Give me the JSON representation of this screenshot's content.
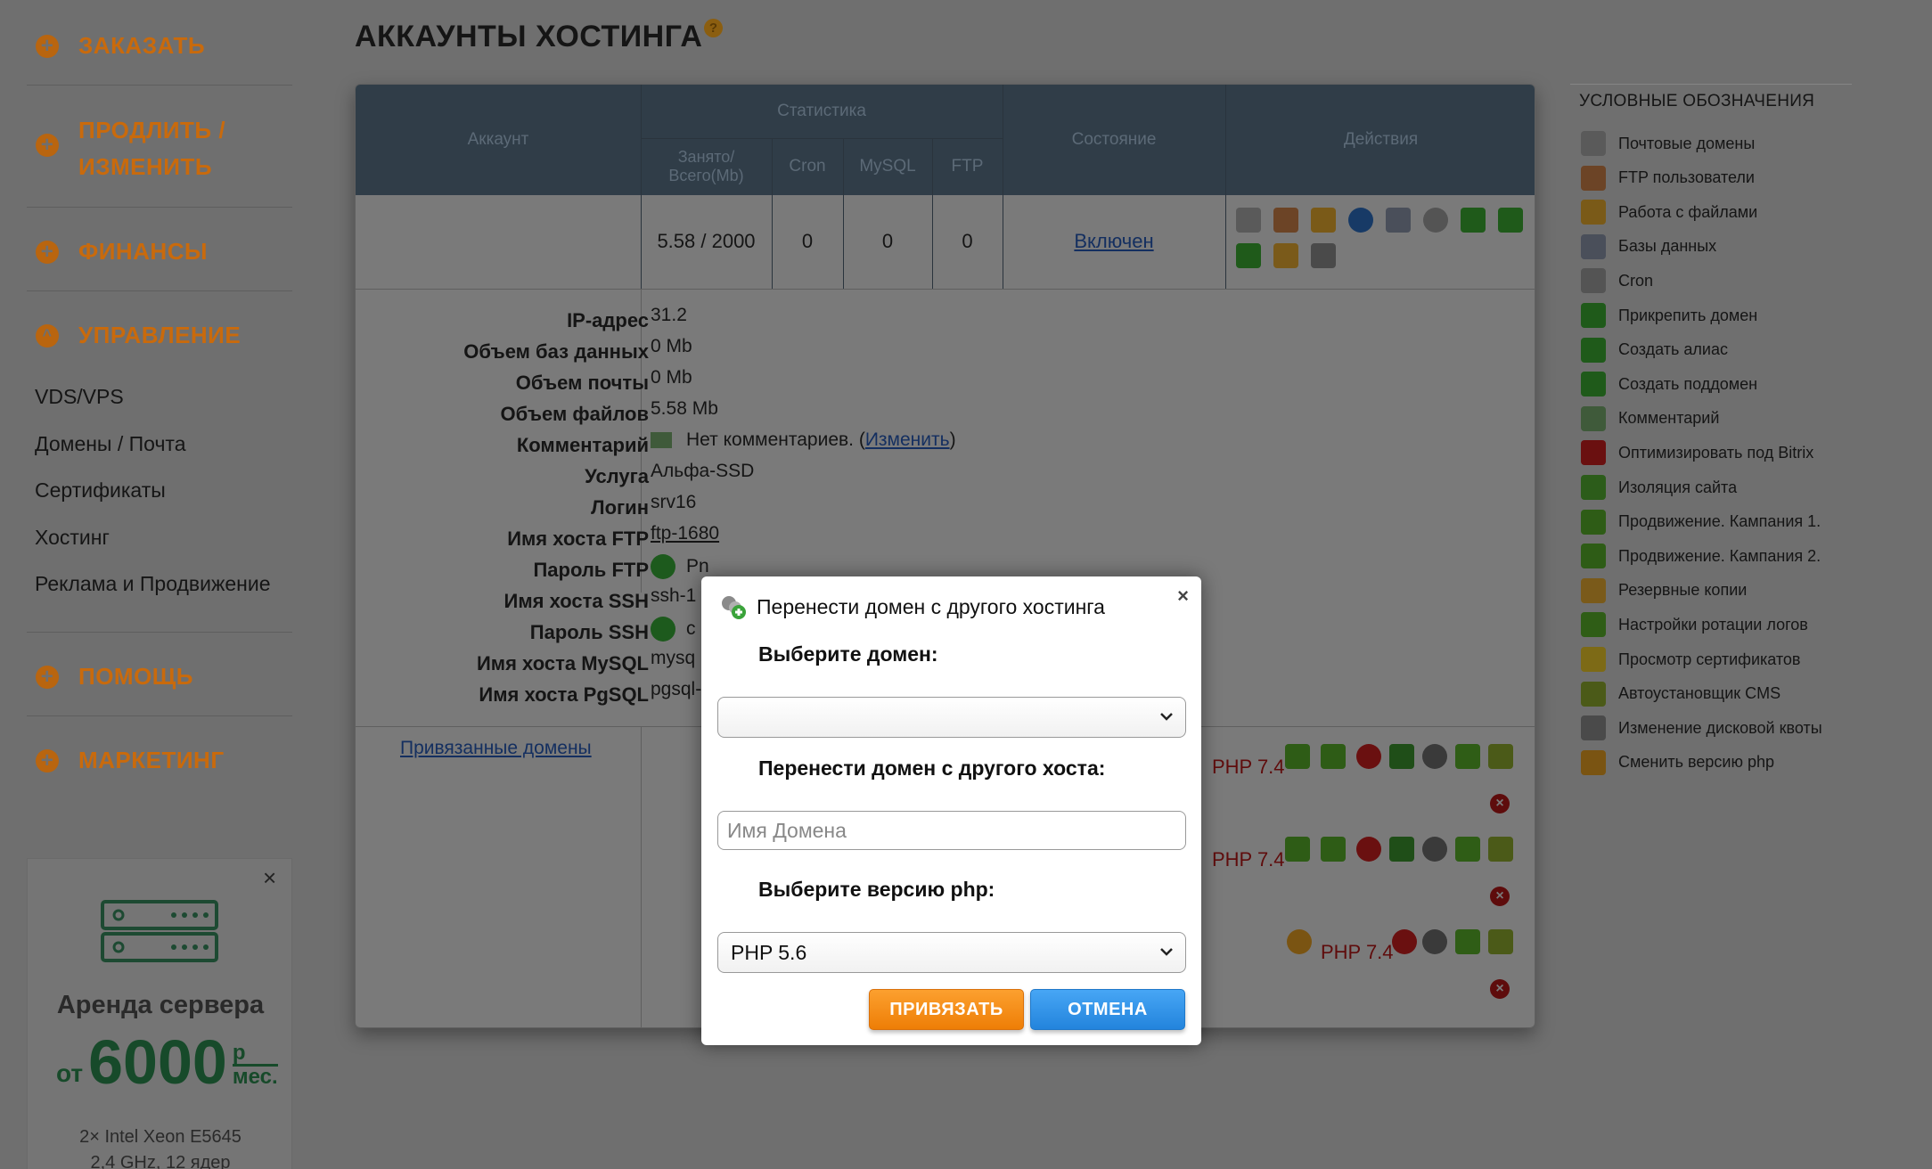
{
  "menu": {
    "order": "ЗАКАЗАТЬ",
    "renew_line1": "ПРОДЛИТЬ /",
    "renew_line2": "ИЗМЕНИТЬ",
    "finance": "ФИНАНСЫ",
    "manage": "УПРАВЛЕНИЕ",
    "manage_items": [
      "VDS/VPS",
      "Домены / Почта",
      "Сертификаты",
      "Хостинг",
      "Реклама и Продвижение"
    ],
    "help": "ПОМОЩЬ",
    "marketing": "МАРКЕТИНГ"
  },
  "ad": {
    "title": "Аренда сервера",
    "price_prefix": "от",
    "price": "6000",
    "unit_top": "р",
    "unit_bottom": "мес.",
    "spec1": "2× Intel Xeon E5645",
    "spec2": "2,4 GHz, 12 ядер",
    "close": "×"
  },
  "page": {
    "title": "АККАУНТЫ ХОСТИНГА",
    "help": "?"
  },
  "table": {
    "col_account": "Аккаунт",
    "col_stats": "Статистика",
    "col_used": "Занято/ Всего(Mb)",
    "col_cron": "Cron",
    "col_mysql": "MySQL",
    "col_ftp": "FTP",
    "col_state": "Состояние",
    "col_actions": "Действия",
    "row": {
      "used": "5.58 / 2000",
      "cron": "0",
      "mysql": "0",
      "ftp": "0",
      "state": "Включен"
    }
  },
  "details": {
    "labels": [
      "IP-адрес",
      "Объем баз данных",
      "Объем почты",
      "Объем файлов",
      "Комментарий",
      "Услуга",
      "Логин",
      "Имя хоста FTP",
      "Пароль FTP",
      "Имя хоста SSH",
      "Пароль SSH",
      "Имя хоста MySQL",
      "Имя хоста PgSQL"
    ],
    "ip": "31.2",
    "db": "0 Mb",
    "mail": "0 Mb",
    "files": "5.58 Mb",
    "comment": "Нет комментариев. (",
    "comment_link": "Изменить",
    "comment_end": ")",
    "service": "Альфа-SSD",
    "login": "srv16",
    "ftp_host": "ftp-1680",
    "ftp_pass": "Pn",
    "ssh_host": "ssh-1",
    "ssh_pass": "c",
    "mysql_host": "mysq",
    "pgsql_host": "pgsql-"
  },
  "domains": {
    "link": "Привязанные домены",
    "php_label": "PHP 7.4"
  },
  "legend": {
    "title": "УСЛОВНЫЕ ОБОЗНАЧЕНИЯ",
    "items": [
      {
        "label": "Почтовые домены",
        "icon": "mail-domain-icon",
        "color": "#5a5a5a"
      },
      {
        "label": "FTP пользователи",
        "icon": "ftp-users-icon",
        "color": "#6c4426"
      },
      {
        "label": "Работа с файлами",
        "icon": "folder-icon",
        "color": "#7a5a18"
      },
      {
        "label": "Базы данных",
        "icon": "database-icon",
        "color": "#4a4f5a"
      },
      {
        "label": "Cron",
        "icon": "clock-icon",
        "color": "#545454"
      },
      {
        "label": "Прикрепить домен",
        "icon": "attach-domain-icon",
        "color": "#1f5a1a"
      },
      {
        "label": "Создать алиас",
        "icon": "alias-icon",
        "color": "#1f5a1a"
      },
      {
        "label": "Создать поддомен",
        "icon": "subdomain-icon",
        "color": "#1f5a1a"
      },
      {
        "label": "Комментарий",
        "icon": "comment-icon",
        "color": "#3f5a3a"
      },
      {
        "label": "Оптимизировать под Bitrix",
        "icon": "bitrix-icon",
        "color": "#6a1010"
      },
      {
        "label": "Изоляция сайта",
        "icon": "isolation-icon",
        "color": "#2c5c1a"
      },
      {
        "label": "Продвижение. Кампания 1.",
        "icon": "campaign1-icon",
        "color": "#2e5c16"
      },
      {
        "label": "Продвижение. Кампания 2.",
        "icon": "campaign2-icon",
        "color": "#2e5c16"
      },
      {
        "label": "Резервные копии",
        "icon": "backup-icon",
        "color": "#7a5a1a"
      },
      {
        "label": "Настройки ротации логов",
        "icon": "log-rotation-icon",
        "color": "#2f5d16"
      },
      {
        "label": "Просмотр сертификатов",
        "icon": "certificate-icon",
        "color": "#7d6a16"
      },
      {
        "label": "Автоустановщик CMS",
        "icon": "cms-installer-icon",
        "color": "#4b5a18"
      },
      {
        "label": "Изменение дисковой квоты",
        "icon": "disk-quota-icon",
        "color": "#4a4a4a"
      },
      {
        "label": "Сменить версию php",
        "icon": "php-version-icon",
        "color": "#7a5412"
      }
    ]
  },
  "modal": {
    "title": "Перенести домен с другого хостинга",
    "close": "×",
    "label_domain": "Выберите домен:",
    "select_domain_value": "",
    "label_host": "Перенести домен с другого хоста:",
    "input_placeholder": "Имя Домена",
    "input_value": "",
    "label_php": "Выберите версию php:",
    "select_php_value": "PHP 5.6",
    "ok": "ПРИВЯЗАТЬ",
    "cancel": "ОТМЕНА"
  }
}
